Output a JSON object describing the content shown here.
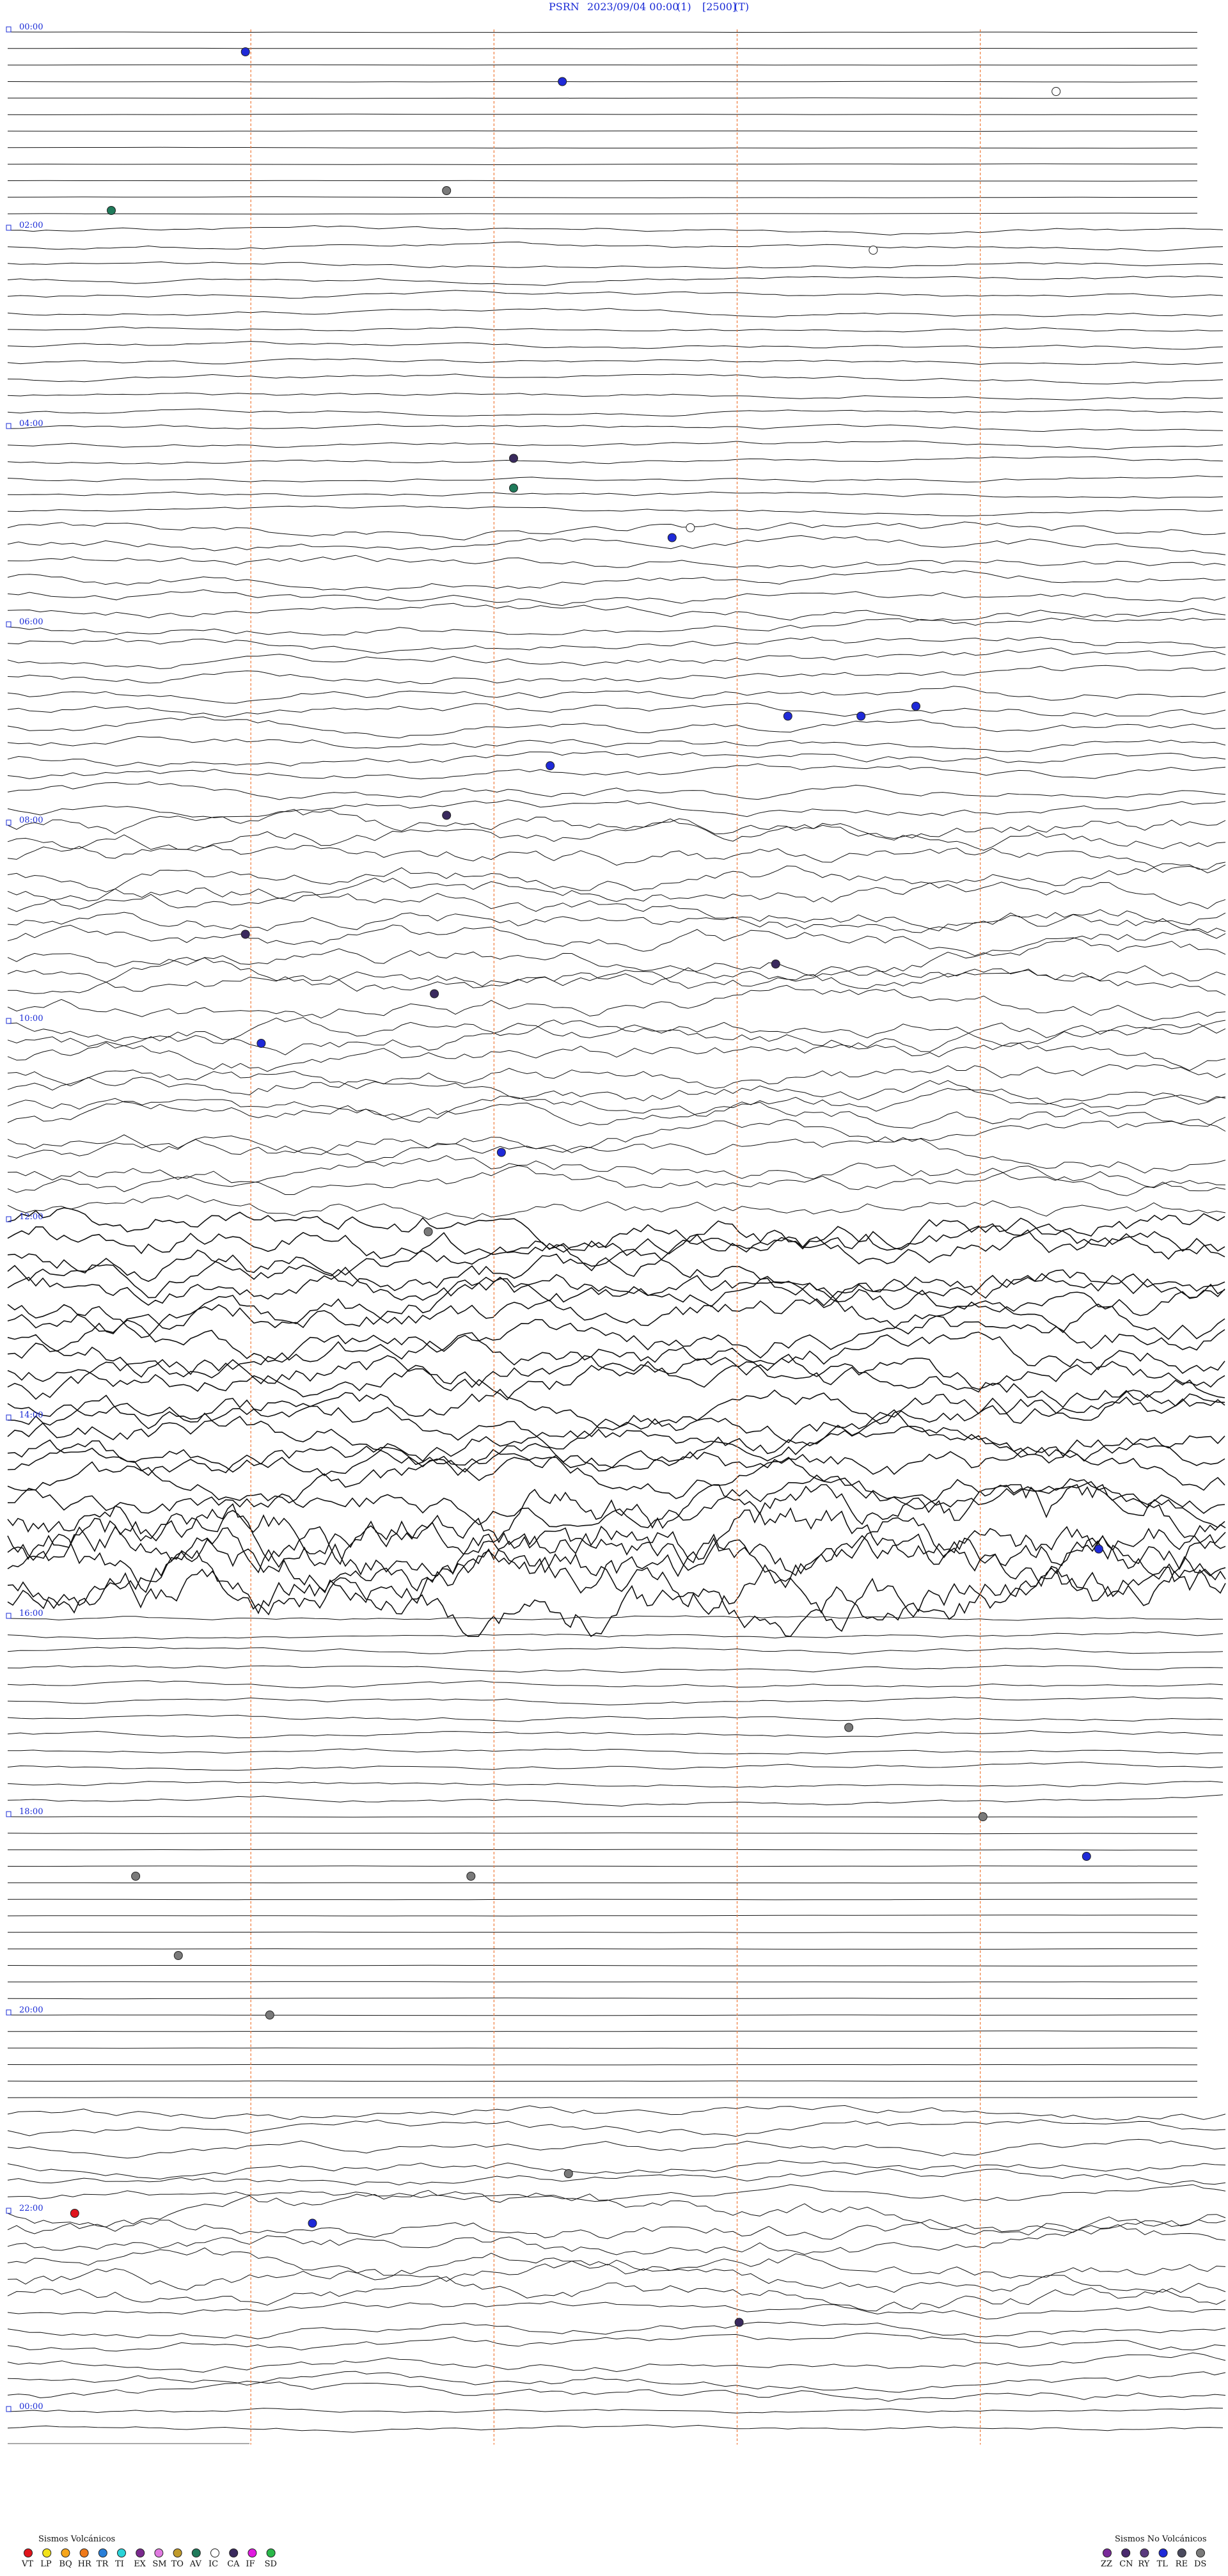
{
  "header": {
    "station": "PSRN",
    "datetime": "2023/09/04 00:00",
    "channel": "(1)",
    "scale": "[2500]",
    "mode": "(T)"
  },
  "chart_data": {
    "type": "helicorder",
    "title": "",
    "xlabel": "",
    "ylabel": "",
    "hour_labels": [
      "00:00",
      "02:00",
      "04:00",
      "06:00",
      "08:00",
      "10:00",
      "12:00",
      "14:00",
      "16:00",
      "18:00",
      "20:00",
      "22:00",
      "00:00"
    ],
    "x_range_minutes": [
      0,
      10
    ],
    "time_markers_minutes": [
      2,
      4,
      6,
      8
    ],
    "grid": true,
    "activity_by_hour": [
      1,
      1,
      2,
      2,
      2,
      3,
      3,
      3,
      4,
      4,
      4,
      4,
      5,
      5,
      5,
      6,
      2,
      2,
      1,
      1,
      1,
      3,
      4,
      3,
      2
    ],
    "events": [
      {
        "hour": 0.2,
        "x": 0.195,
        "type": "TL"
      },
      {
        "hour": 0.5,
        "x": 0.455,
        "type": "TL"
      },
      {
        "hour": 0.6,
        "x": 0.86,
        "type": "IC"
      },
      {
        "hour": 1.6,
        "x": 0.36,
        "type": "DS"
      },
      {
        "hour": 1.8,
        "x": 0.085,
        "type": "AV"
      },
      {
        "hour": 2.2,
        "x": 0.71,
        "type": "IC"
      },
      {
        "hour": 4.3,
        "x": 0.415,
        "type": "CA"
      },
      {
        "hour": 4.6,
        "x": 0.415,
        "type": "AV"
      },
      {
        "hour": 5.0,
        "x": 0.56,
        "type": "IC"
      },
      {
        "hour": 5.1,
        "x": 0.545,
        "type": "TL"
      },
      {
        "hour": 6.9,
        "x": 0.64,
        "type": "TL"
      },
      {
        "hour": 6.9,
        "x": 0.7,
        "type": "TL"
      },
      {
        "hour": 6.8,
        "x": 0.745,
        "type": "TL"
      },
      {
        "hour": 7.4,
        "x": 0.445,
        "type": "TL"
      },
      {
        "hour": 7.9,
        "x": 0.36,
        "type": "CA"
      },
      {
        "hour": 9.1,
        "x": 0.195,
        "type": "CA"
      },
      {
        "hour": 9.4,
        "x": 0.63,
        "type": "CA"
      },
      {
        "hour": 9.7,
        "x": 0.35,
        "type": "CA"
      },
      {
        "hour": 10.2,
        "x": 0.208,
        "type": "TL"
      },
      {
        "hour": 11.3,
        "x": 0.405,
        "type": "TL"
      },
      {
        "hour": 12.1,
        "x": 0.345,
        "type": "DS"
      },
      {
        "hour": 15.3,
        "x": 0.895,
        "type": "TL"
      },
      {
        "hour": 17.1,
        "x": 0.69,
        "type": "DS"
      },
      {
        "hour": 18.0,
        "x": 0.8,
        "type": "DS"
      },
      {
        "hour": 18.4,
        "x": 0.885,
        "type": "TL"
      },
      {
        "hour": 18.6,
        "x": 0.105,
        "type": "DS"
      },
      {
        "hour": 18.6,
        "x": 0.38,
        "type": "DS"
      },
      {
        "hour": 19.4,
        "x": 0.14,
        "type": "DS"
      },
      {
        "hour": 20.0,
        "x": 0.215,
        "type": "DS"
      },
      {
        "hour": 21.6,
        "x": 0.46,
        "type": "DS"
      },
      {
        "hour": 22.0,
        "x": 0.055,
        "type": "VT"
      },
      {
        "hour": 22.1,
        "x": 0.25,
        "type": "TL"
      },
      {
        "hour": 23.1,
        "x": 0.6,
        "type": "CA"
      }
    ]
  },
  "legend": {
    "volcanic": {
      "title": "Sismos Volcánicos",
      "items": [
        {
          "code": "VT",
          "color": "#e0141c",
          "icon": "vt-dot-icon"
        },
        {
          "code": "LP",
          "color": "#f2e21a",
          "icon": "lp-dot-icon"
        },
        {
          "code": "BQ",
          "color": "#f6a51b",
          "icon": "bq-dot-icon"
        },
        {
          "code": "HR",
          "color": "#f07a1a",
          "icon": "hr-dot-icon"
        },
        {
          "code": "TR",
          "color": "#2a7fd8",
          "icon": "tr-dot-icon"
        },
        {
          "code": "TI",
          "color": "#2ad4d9",
          "icon": "ti-dot-icon"
        },
        {
          "code": "EX",
          "color": "#7a2a8e",
          "icon": "ex-dot-icon"
        },
        {
          "code": "SM",
          "color": "#e07ae0",
          "icon": "sm-dot-icon"
        },
        {
          "code": "TO",
          "color": "#c09a2a",
          "icon": "to-dot-icon"
        },
        {
          "code": "AV",
          "color": "#1f7a5a",
          "icon": "av-dot-icon"
        },
        {
          "code": "IC",
          "color": "#ffffff",
          "icon": "ic-dot-icon"
        },
        {
          "code": "CA",
          "color": "#3a2a5e",
          "icon": "ca-dot-icon"
        },
        {
          "code": "IF",
          "color": "#e01ae0",
          "icon": "if-dot-icon"
        },
        {
          "code": "SD",
          "color": "#2ab84a",
          "icon": "sd-dot-icon"
        }
      ]
    },
    "nonvolcanic": {
      "title": "Sismos No Volcánicos",
      "items": [
        {
          "code": "ZZ",
          "color": "#7a2a9a",
          "icon": "zz-dot-icon"
        },
        {
          "code": "CN",
          "color": "#4a2a6e",
          "icon": "cn-dot-icon"
        },
        {
          "code": "RY",
          "color": "#5a3a7e",
          "icon": "ry-dot-icon"
        },
        {
          "code": "TL",
          "color": "#1f2ad8",
          "icon": "tl-dot-icon"
        },
        {
          "code": "RE",
          "color": "#4a4a5e",
          "icon": "re-dot-icon"
        },
        {
          "code": "DS",
          "color": "#7a7a7a",
          "icon": "ds-dot-icon"
        }
      ]
    }
  }
}
